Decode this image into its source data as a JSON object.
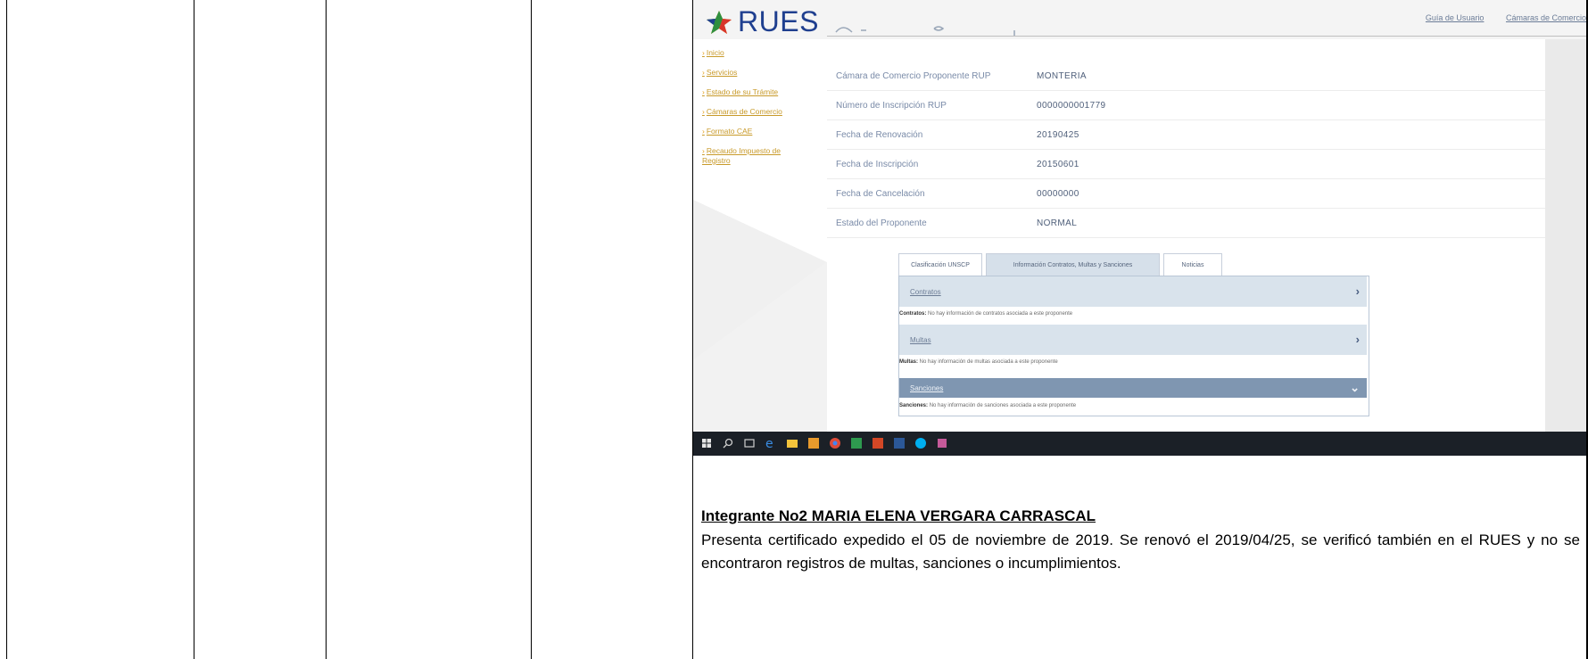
{
  "rues": {
    "logo_text": "RUES",
    "top_links": [
      "Guía de Usuario",
      "Cámaras de Comercio"
    ],
    "sidebar_links": [
      "Inicio",
      "Servicios",
      "Estado de su Trámite",
      "Cámaras de Comercio",
      "Formato CAE",
      "Recaudo Impuesto de Registro"
    ],
    "info_rows": [
      {
        "label": "Cámara de Comercio Proponente RUP",
        "value": "MONTERIA"
      },
      {
        "label": "Número de Inscripción RUP",
        "value": "0000000001779"
      },
      {
        "label": "Fecha de Renovación",
        "value": "20190425"
      },
      {
        "label": "Fecha de Inscripción",
        "value": "20150601"
      },
      {
        "label": "Fecha de Cancelación",
        "value": "00000000"
      },
      {
        "label": "Estado del Proponente",
        "value": "NORMAL"
      }
    ],
    "tabs": [
      "Clasificación UNSCP",
      "Información Contratos, Multas y Sanciones",
      "Noticias"
    ],
    "sections": [
      {
        "title": "Contratos",
        "note_label": "Contratos:",
        "note": "No hay información de contratos asociada a este proponente"
      },
      {
        "title": "Multas",
        "note_label": "Multas:",
        "note": "No hay información de multas asociada a este proponente"
      },
      {
        "title": "Sanciones",
        "note_label": "Sanciones:",
        "note": "No hay información de sanciones asociada a este proponente"
      }
    ]
  },
  "caption": {
    "title": "Integrante No2 MARIA ELENA VERGARA CARRASCAL",
    "text": "Presenta certificado expedido el 05 de noviembre de 2019. Se renovó el 2019/04/25, se verificó también en el RUES y no se encontraron registros de multas, sanciones o incumplimientos."
  },
  "colors": {
    "rues_blue": "#1f3f8f",
    "link_gold": "#c89a2a",
    "tab_active": "#d6e0ea",
    "section_dark": "#7f96b1",
    "taskbar": "#1b2027"
  }
}
